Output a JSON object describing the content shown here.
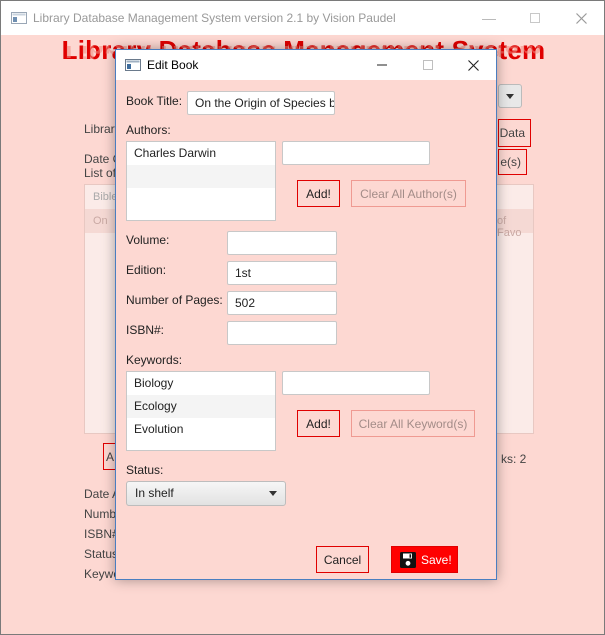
{
  "main_window": {
    "title": "Library Database Management System version 2.1 by Vision Paudel",
    "heading": "Library Database Management System",
    "left_labels": [
      "Library",
      "Date C",
      "List of"
    ],
    "right_buttons": [
      "Data",
      "e(s)"
    ],
    "list_col_head_left": "Bible",
    "list_col_head_right": "",
    "list_row_left": "On",
    "list_row_right": "of Favo",
    "count_text": "ks: 2",
    "lower_labels": [
      "Date A",
      "Numb",
      "ISBN#",
      "Status",
      "Keywo"
    ],
    "lower_btn_left": "A"
  },
  "dialog": {
    "title": "Edit Book",
    "book_title_label": "Book Title:",
    "book_title_value": "On the Origin of Species b",
    "authors_label": "Authors:",
    "authors": [
      "Charles Darwin",
      "",
      ""
    ],
    "author_input": "",
    "add_author_label": "Add!",
    "clear_authors_label": "Clear All Author(s)",
    "volume_label": "Volume:",
    "volume_value": "",
    "edition_label": "Edition:",
    "edition_value": "1st",
    "pages_label": "Number of Pages:",
    "pages_value": "502",
    "isbn_label": "ISBN#:",
    "isbn_value": "",
    "keywords_label": "Keywords:",
    "keywords": [
      "Biology",
      "Ecology",
      "Evolution"
    ],
    "keyword_input": "",
    "add_keyword_label": "Add!",
    "clear_keywords_label": "Clear All Keyword(s)",
    "status_label": "Status:",
    "status_value": "In shelf",
    "cancel_label": "Cancel",
    "save_label": "Save!"
  },
  "colors": {
    "background": "#fdd8d2",
    "accent_red": "#e00000",
    "save_red": "#ff0000"
  },
  "icons": {
    "app": "app-window-icon",
    "save": "floppy-disk-icon",
    "minimize": "minimize-icon",
    "maximize": "maximize-icon",
    "close": "close-icon",
    "dropdown": "chevron-down-icon"
  }
}
